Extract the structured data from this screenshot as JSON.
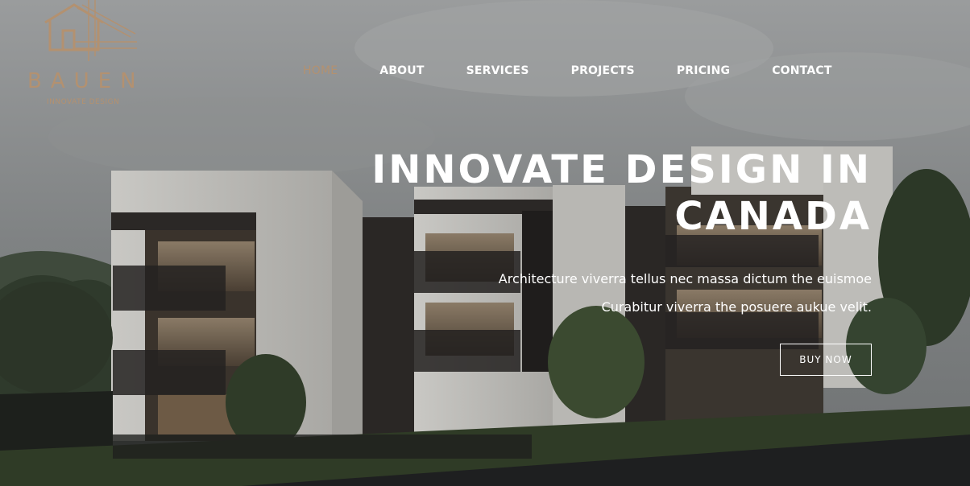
{
  "brand": {
    "name": "BAUEN",
    "tagline": "INNOVATE DESIGN",
    "accent_color": "#b39170",
    "logo_icon": "house-blueprint-icon"
  },
  "nav": {
    "items": [
      {
        "label": "HOME",
        "active": true
      },
      {
        "label": "ABOUT",
        "active": false
      },
      {
        "label": "SERVICES",
        "active": false
      },
      {
        "label": "PROJECTS",
        "active": false
      },
      {
        "label": "PRICING",
        "active": false
      },
      {
        "label": "CONTACT",
        "active": false
      }
    ]
  },
  "hero": {
    "title_line1": "INNOVATE DESIGN IN",
    "title_line2": "CANADA",
    "subtitle_line1": "Architecture viverra tellus nec massa dictum the euismoe",
    "subtitle_line2": "Curabitur viverra the posuere aukue velit.",
    "cta_label": "BUY NOW"
  }
}
